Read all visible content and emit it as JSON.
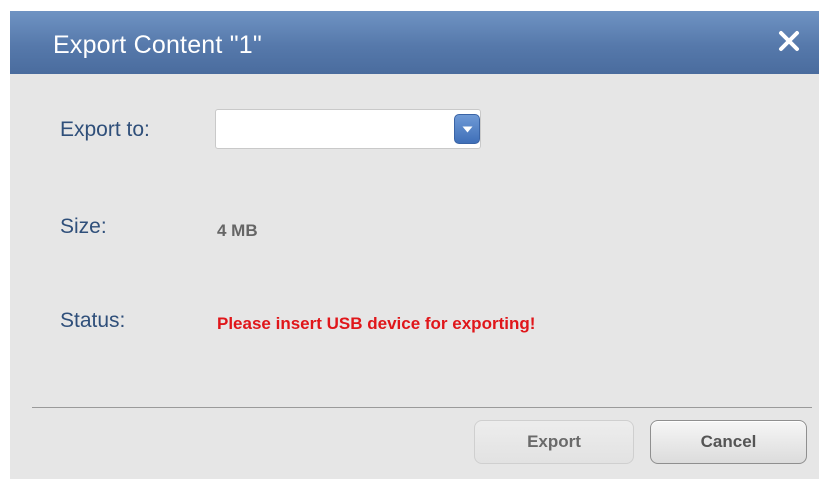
{
  "dialog": {
    "title": "Export Content \"1\"",
    "close_icon": "close-icon"
  },
  "form": {
    "export_to_label": "Export to:",
    "export_to_value": "",
    "export_to_icon": "chevron-down-icon",
    "size_label": "Size:",
    "size_value": "4 MB",
    "status_label": "Status:",
    "status_value": "Please insert USB device for exporting!"
  },
  "buttons": {
    "export_label": "Export",
    "cancel_label": "Cancel"
  },
  "colors": {
    "titlebar": "#5679ab",
    "label_text": "#2f4f7a",
    "status_error": "#e0161a",
    "background": "#e6e6e6"
  }
}
